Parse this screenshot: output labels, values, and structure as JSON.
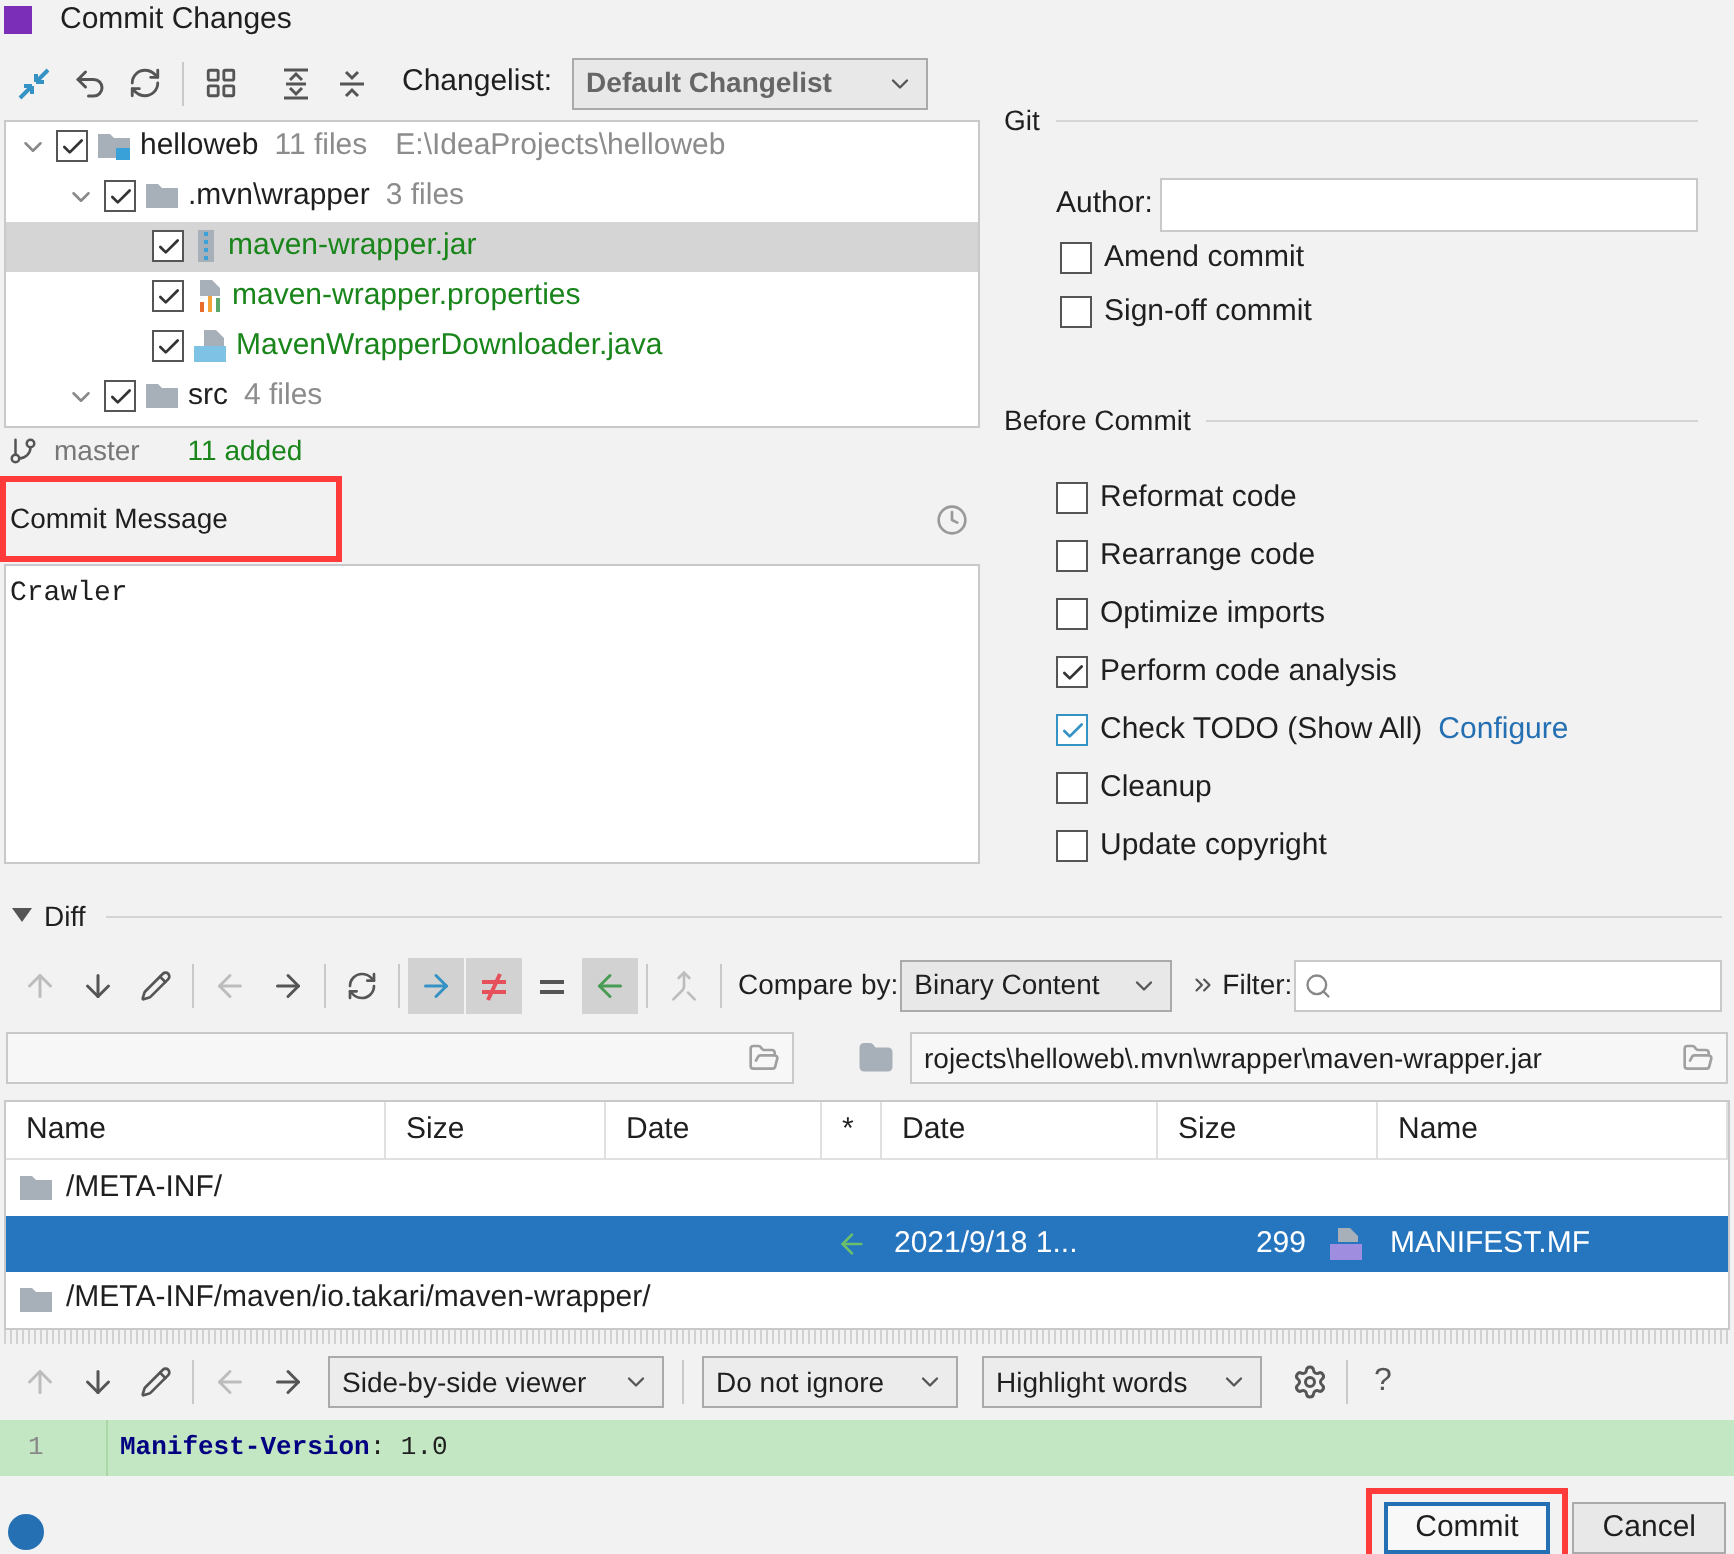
{
  "window": {
    "title": "Commit Changes"
  },
  "changelist": {
    "label": "Changelist:",
    "value": "Default Changelist"
  },
  "tree": [
    {
      "kind": "project",
      "label": "helloweb",
      "meta": "11 files",
      "path": "E:\\IdeaProjects\\helloweb",
      "expanded": true,
      "checked": true,
      "selected": false,
      "added": false,
      "children": [
        {
          "kind": "folder",
          "label": ".mvn\\wrapper",
          "meta": "3 files",
          "expanded": true,
          "checked": true,
          "selected": false,
          "added": false,
          "children": [
            {
              "kind": "jar",
              "label": "maven-wrapper.jar",
              "checked": true,
              "selected": true,
              "added": true
            },
            {
              "kind": "properties",
              "label": "maven-wrapper.properties",
              "checked": true,
              "selected": false,
              "added": true
            },
            {
              "kind": "java",
              "label": "MavenWrapperDownloader.java",
              "checked": true,
              "selected": false,
              "added": true
            }
          ]
        },
        {
          "kind": "folder",
          "label": "src",
          "meta": "4 files",
          "checked": true,
          "selected": false,
          "added": false
        }
      ]
    }
  ],
  "status": {
    "branch": "master",
    "summary": "11 added"
  },
  "commit_message": {
    "label": "Commit Message",
    "value": "Crawler",
    "highlighted": true
  },
  "git": {
    "title": "Git",
    "author_label": "Author:",
    "options": [
      {
        "label": "Amend commit",
        "checked": false
      },
      {
        "label": "Sign-off commit",
        "checked": false
      }
    ]
  },
  "before_commit": {
    "title": "Before Commit",
    "options": [
      {
        "label": "Reformat code",
        "checked": false
      },
      {
        "label": "Rearrange code",
        "checked": false
      },
      {
        "label": "Optimize imports",
        "checked": false
      },
      {
        "label": "Perform code analysis",
        "checked": true
      },
      {
        "label": "Check TODO (Show All)",
        "checked": true,
        "link": "Configure"
      },
      {
        "label": "Cleanup",
        "checked": false
      },
      {
        "label": "Update copyright",
        "checked": false
      }
    ]
  },
  "diff": {
    "title": "Diff",
    "expanded": true,
    "toolbar": [
      {
        "kind": "up",
        "disabled": true,
        "on": false
      },
      {
        "kind": "down",
        "disabled": false,
        "on": false
      },
      {
        "kind": "edit",
        "disabled": false,
        "on": false
      },
      {
        "kind": "sep"
      },
      {
        "kind": "left",
        "disabled": true,
        "on": false
      },
      {
        "kind": "right",
        "disabled": false,
        "on": false
      },
      {
        "kind": "sep"
      },
      {
        "kind": "refresh",
        "disabled": false,
        "on": false
      },
      {
        "kind": "sep"
      },
      {
        "kind": "copy-right",
        "disabled": false,
        "on": true
      },
      {
        "kind": "different",
        "disabled": false,
        "on": true
      },
      {
        "kind": "equal",
        "disabled": false,
        "on": false
      },
      {
        "kind": "copy-left",
        "disabled": false,
        "on": true
      },
      {
        "kind": "sep"
      },
      {
        "kind": "merge",
        "disabled": true,
        "on": false
      },
      {
        "kind": "sep"
      }
    ],
    "compare_label": "Compare by:",
    "compare_value": "Binary Content",
    "filter_label": "Filter:",
    "right_path": "rojects\\helloweb\\.mvn\\wrapper\\maven-wrapper.jar",
    "columns": [
      "Name",
      "Size",
      "Date",
      "*",
      "Date",
      "Size",
      "Name"
    ],
    "rows": [
      {
        "kind": "folder",
        "name": "/META-INF/",
        "selected": false
      },
      {
        "kind": "file",
        "date": "2021/9/18 1...",
        "size": "299",
        "name": "MANIFEST.MF",
        "selected": true
      },
      {
        "kind": "folder",
        "name": "/META-INF/maven/io.takari/maven-wrapper/",
        "selected": false
      }
    ],
    "toolbar2": [
      {
        "kind": "up",
        "disabled": true
      },
      {
        "kind": "down",
        "disabled": false
      },
      {
        "kind": "edit",
        "disabled": false
      },
      {
        "kind": "sep"
      },
      {
        "kind": "left",
        "disabled": true
      },
      {
        "kind": "right",
        "disabled": false
      }
    ],
    "viewer": "Side-by-side viewer",
    "ignore": "Do not ignore",
    "highlight": "Highlight words",
    "help": "?",
    "lines": [
      {
        "number": "1",
        "text": "**Manifest-Version**: 1.0"
      }
    ]
  },
  "buttons": [
    {
      "label": "Commit",
      "highlighted": true
    },
    {
      "label": "Cancel",
      "highlighted": false
    }
  ]
}
